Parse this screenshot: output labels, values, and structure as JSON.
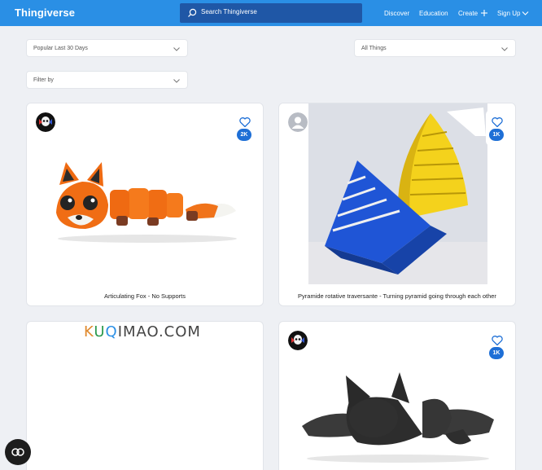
{
  "header": {
    "logo": "Thingiverse",
    "search_placeholder": "Search Thingiverse",
    "nav": {
      "discover": "Discover",
      "education": "Education",
      "create": "Create",
      "signup": "Sign Up"
    }
  },
  "filters": {
    "sort": "Popular Last 30 Days",
    "category": "All Things",
    "filter_by": "Filter by"
  },
  "cards": [
    {
      "title": "Articulating Fox - No Supports",
      "likes": "2K"
    },
    {
      "title": "Pyramide rotative traversante - Turning pyramid going through each other",
      "likes": "1K"
    },
    {
      "title": "",
      "likes": ""
    },
    {
      "title": "",
      "likes": "1K"
    }
  ],
  "watermark": {
    "k": "K",
    "u": "U",
    "q": "Q",
    "rest": "IMAO.COM"
  },
  "colors": {
    "header": "#2a8fe5",
    "search_bg": "#1f57a6",
    "badge": "#1e6fd6"
  }
}
